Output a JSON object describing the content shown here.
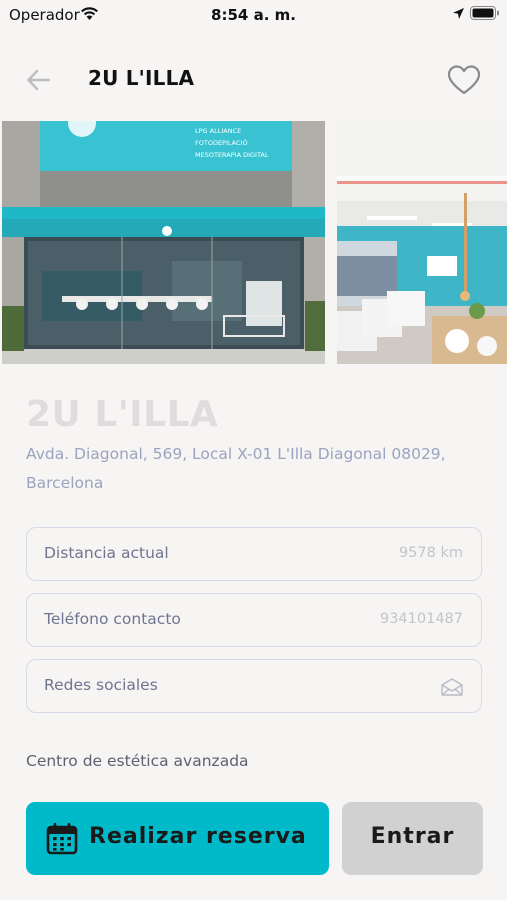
{
  "status_bar": {
    "carrier": "Operador",
    "time": "8:54 a. m."
  },
  "nav": {
    "title": "2U L'ILLA"
  },
  "gallery": {
    "photo_1": {
      "sign_lines": [
        "LPG ALLIANCE",
        "FOTODEPILACIÓ",
        "MESOTERAPIA DIGITAL"
      ]
    }
  },
  "venue": {
    "name": "2U L'ILLA",
    "address": "Avda. Diagonal, 569, Local X-01 L'Illa Diagonal 08029, Barcelona"
  },
  "fields": {
    "distance": {
      "label": "Distancia actual",
      "value": "9578 km"
    },
    "phone": {
      "label": "Teléfono contacto",
      "value": "934101487"
    },
    "social": {
      "label": "Redes sociales",
      "icon": "mail-icon"
    }
  },
  "description": "Centro de estética avanzada",
  "actions": {
    "reserve_label": "Realizar reserva",
    "enter_label": "Entrar"
  },
  "colors": {
    "accent": "#00b9c9",
    "secondary_button": "#d1d1d1",
    "background": "#f7f4f4"
  }
}
